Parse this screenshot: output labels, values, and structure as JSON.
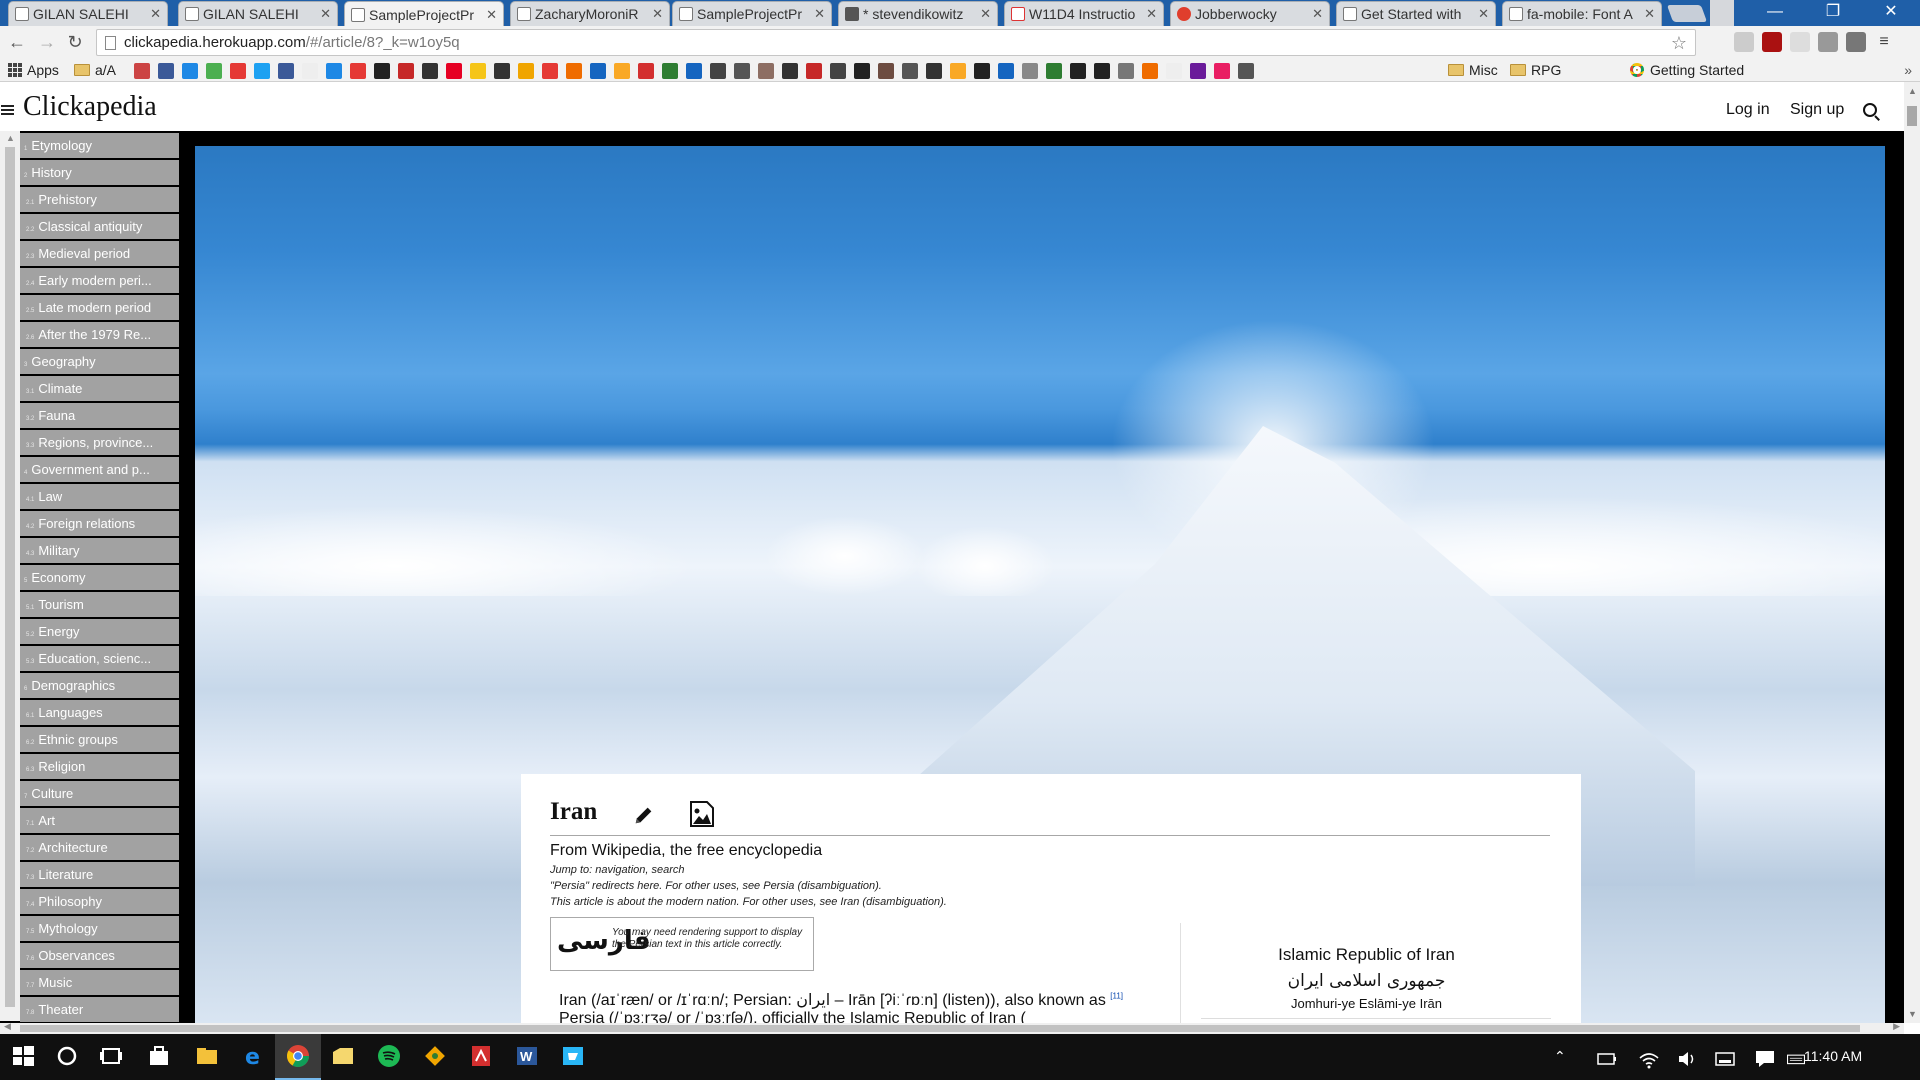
{
  "browser": {
    "tabs": [
      {
        "title": "GILAN SALEHI",
        "favicon": "doc-icon"
      },
      {
        "title": "GILAN SALEHI",
        "favicon": "doc-icon"
      },
      {
        "title": "SampleProjectPr",
        "favicon": "doc-icon",
        "active": true
      },
      {
        "title": "ZacharyMoroniR",
        "favicon": "doc-icon"
      },
      {
        "title": "SampleProjectPr",
        "favicon": "doc-icon"
      },
      {
        "title": "* stevendikowitz",
        "favicon": "hash-icon"
      },
      {
        "title": "W11D4 Instructio",
        "favicon": "gmail-icon"
      },
      {
        "title": "Jobberwocky",
        "favicon": "red-circle-icon"
      },
      {
        "title": "Get Started with",
        "favicon": "doc-icon"
      },
      {
        "title": "fa-mobile: Font A",
        "favicon": "doc-icon"
      }
    ],
    "url_host": "clickapedia.herokuapp.com",
    "url_path": "/#/article/8?_k=w1oy5q",
    "bookmarks": {
      "apps": "Apps",
      "first_folder": "a/A",
      "misc": "Misc",
      "rpg": "RPG",
      "getting_started": "Getting Started",
      "more": "»"
    }
  },
  "header": {
    "brand": "Clickapedia",
    "login": "Log in",
    "signup": "Sign up"
  },
  "toc": [
    {
      "num": "1",
      "label": "Etymology"
    },
    {
      "num": "2",
      "label": "History"
    },
    {
      "num": "2.1",
      "label": "Prehistory"
    },
    {
      "num": "2.2",
      "label": "Classical antiquity"
    },
    {
      "num": "2.3",
      "label": "Medieval period"
    },
    {
      "num": "2.4",
      "label": "Early modern peri..."
    },
    {
      "num": "2.5",
      "label": "Late modern period"
    },
    {
      "num": "2.6",
      "label": "After the 1979 Re..."
    },
    {
      "num": "3",
      "label": "Geography"
    },
    {
      "num": "3.1",
      "label": "Climate"
    },
    {
      "num": "3.2",
      "label": "Fauna"
    },
    {
      "num": "3.3",
      "label": "Regions, province..."
    },
    {
      "num": "4",
      "label": "Government and p..."
    },
    {
      "num": "4.1",
      "label": "Law"
    },
    {
      "num": "4.2",
      "label": "Foreign relations"
    },
    {
      "num": "4.3",
      "label": "Military"
    },
    {
      "num": "5",
      "label": "Economy"
    },
    {
      "num": "5.1",
      "label": "Tourism"
    },
    {
      "num": "5.2",
      "label": "Energy"
    },
    {
      "num": "5.3",
      "label": "Education, scienc..."
    },
    {
      "num": "6",
      "label": "Demographics"
    },
    {
      "num": "6.1",
      "label": "Languages"
    },
    {
      "num": "6.2",
      "label": "Ethnic groups"
    },
    {
      "num": "6.3",
      "label": "Religion"
    },
    {
      "num": "7",
      "label": "Culture"
    },
    {
      "num": "7.1",
      "label": "Art"
    },
    {
      "num": "7.2",
      "label": "Architecture"
    },
    {
      "num": "7.3",
      "label": "Literature"
    },
    {
      "num": "7.4",
      "label": "Philosophy"
    },
    {
      "num": "7.5",
      "label": "Mythology"
    },
    {
      "num": "7.6",
      "label": "Observances"
    },
    {
      "num": "7.7",
      "label": "Music"
    },
    {
      "num": "7.8",
      "label": "Theater"
    }
  ],
  "article": {
    "title": "Iran",
    "subtitle": "From Wikipedia, the free encyclopedia",
    "jump": "Jump to: navigation, search",
    "redirect_note": "\"Persia\" redirects here. For other uses, see Persia (disambiguation).",
    "about_note": "This article is about the modern nation. For other uses, see Iran (disambiguation).",
    "farsi_glyph": "فارسی",
    "farsi_note": "You may need rendering support to display the Persian text in this article correctly.",
    "lead_line1": "Iran (/aɪˈræn/ or /ɪˈrɑːn/; Persian: ایران – Irān [ʔiːˈɾɒːn] (listen)), also known as",
    "lead_line2": "Persia (/ˈpɜːrʒə/ or /ˈpɜːrʃə/), officially the Islamic Republic of Iran (",
    "lead_refs": "[11]",
    "infobox": {
      "name": "Islamic Republic of Iran",
      "native": "جمهوری اسلامی ایران",
      "transliteration": "Jomhuri-ye Eslāmi-ye Irān"
    }
  },
  "taskbar": {
    "clock": "11:40 AM"
  },
  "colors": {
    "tabstrip": "#1f5fa8",
    "toc_bg": "#a2a2a2",
    "stage": "#000000",
    "taskbar": "#101010"
  }
}
